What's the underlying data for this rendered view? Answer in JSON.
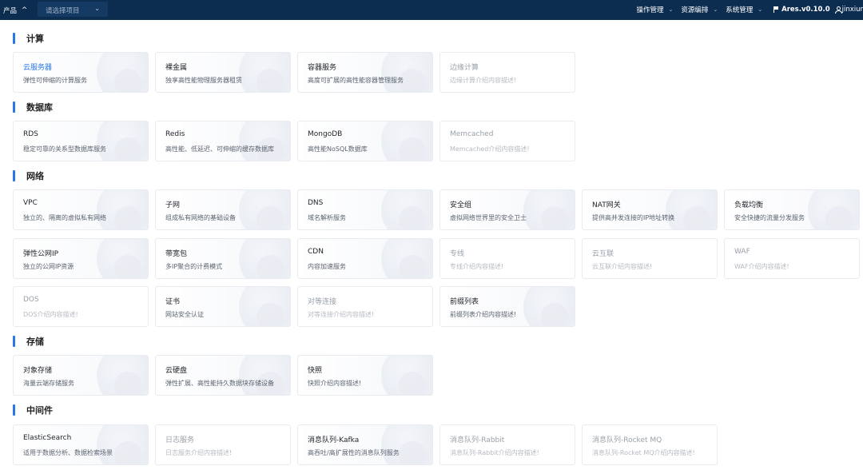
{
  "topbar": {
    "product_label": "产品",
    "product_chevron": "^",
    "select_placeholder": "请选择项目",
    "menus": [
      "操作管理",
      "资源编排",
      "系统管理"
    ],
    "version": "Ares.v0.10.0",
    "user": "jinxiur",
    "icons": [
      "chevron-up-icon",
      "chevron-down-icon",
      "flag-icon",
      "user-icon"
    ]
  },
  "sections": [
    {
      "title": "计算",
      "cards": [
        {
          "title": "云服务器",
          "desc": "弹性可伸缩的计算服务",
          "state": "active"
        },
        {
          "title": "裸金属",
          "desc": "独享高性能物理服务器租赁",
          "state": "normal"
        },
        {
          "title": "容器服务",
          "desc": "高度可扩展的高性能容器管理服务",
          "state": "normal"
        },
        {
          "title": "边缘计算",
          "desc": "边缘计算介绍内容描述!",
          "state": "disabled"
        }
      ]
    },
    {
      "title": "数据库",
      "cards": [
        {
          "title": "RDS",
          "desc": "稳定可靠的关系型数据库服务",
          "state": "normal"
        },
        {
          "title": "Redis",
          "desc": "高性能、低延迟、可伸缩的缓存数据库",
          "state": "normal"
        },
        {
          "title": "MongoDB",
          "desc": "高性能NoSQL数据库",
          "state": "normal"
        },
        {
          "title": "Memcached",
          "desc": "Memcached介绍内容描述!",
          "state": "disabled"
        }
      ]
    },
    {
      "title": "网络",
      "cards": [
        {
          "title": "VPC",
          "desc": "独立的、隔离的虚拟私有网络",
          "state": "normal"
        },
        {
          "title": "子网",
          "desc": "组成私有网络的基础设备",
          "state": "normal"
        },
        {
          "title": "DNS",
          "desc": "域名解析服务",
          "state": "normal"
        },
        {
          "title": "安全组",
          "desc": "虚拟网络世界里的安全卫士",
          "state": "normal"
        },
        {
          "title": "NAT网关",
          "desc": "提供高并发连接的IP地址转换",
          "state": "normal"
        },
        {
          "title": "负载均衡",
          "desc": "安全快捷的流量分发服务",
          "state": "normal"
        },
        {
          "title": "弹性公网IP",
          "desc": "独立的公网IP资源",
          "state": "normal"
        },
        {
          "title": "带宽包",
          "desc": "多IP聚合的计费模式",
          "state": "normal"
        },
        {
          "title": "CDN",
          "desc": "内容加速服务",
          "state": "normal"
        },
        {
          "title": "专线",
          "desc": "专线介绍内容描述!",
          "state": "disabled"
        },
        {
          "title": "云互联",
          "desc": "云互联介绍内容描述!",
          "state": "disabled"
        },
        {
          "title": "WAF",
          "desc": "WAF介绍内容描述!",
          "state": "disabled"
        },
        {
          "title": "DOS",
          "desc": "DOS介绍内容描述!",
          "state": "disabled"
        },
        {
          "title": "证书",
          "desc": "网站安全认证",
          "state": "normal"
        },
        {
          "title": "对等连接",
          "desc": "对等连接介绍内容描述!",
          "state": "disabled"
        },
        {
          "title": "前缀列表",
          "desc": "前缀列表介绍内容描述!",
          "state": "normal"
        }
      ]
    },
    {
      "title": "存储",
      "cards": [
        {
          "title": "对象存储",
          "desc": "海量云端存储服务",
          "state": "normal"
        },
        {
          "title": "云硬盘",
          "desc": "弹性扩展、高性能持久数据块存储设备",
          "state": "normal"
        },
        {
          "title": "快照",
          "desc": "快照介绍内容描述!",
          "state": "normal"
        }
      ]
    },
    {
      "title": "中间件",
      "cards": [
        {
          "title": "ElasticSearch",
          "desc": "适用于数据分析、数据检索场景",
          "state": "normal"
        },
        {
          "title": "日志服务",
          "desc": "日志服务介绍内容描述!",
          "state": "disabled"
        },
        {
          "title": "消息队列-Kafka",
          "desc": "高吞吐/高扩展性的消息队列服务",
          "state": "normal"
        },
        {
          "title": "消息队列-Rabbit",
          "desc": "消息队列-Rabbit介绍内容描述!",
          "state": "disabled"
        },
        {
          "title": "消息队列-Rocket MQ",
          "desc": "消息队列-Rocket MQ介绍内容描述!",
          "state": "disabled"
        }
      ]
    }
  ],
  "colors": {
    "topbar": "#0c2d50",
    "accent": "#2a78e4",
    "disabled_text": "#9aa1aa"
  }
}
